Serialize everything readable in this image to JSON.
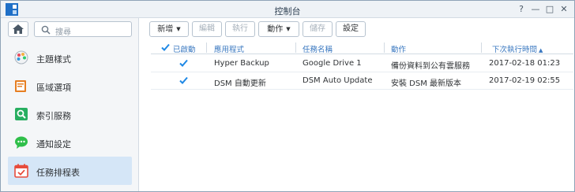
{
  "window": {
    "title": "控制台",
    "controls": [
      "?",
      "—",
      "□",
      "✕"
    ]
  },
  "sidebar": {
    "search_placeholder": "搜尋",
    "items": [
      {
        "label": "主題樣式",
        "icon": "palette-icon",
        "active": false
      },
      {
        "label": "區域選項",
        "icon": "regional-icon",
        "active": false
      },
      {
        "label": "索引服務",
        "icon": "index-search-icon",
        "active": false
      },
      {
        "label": "通知設定",
        "icon": "notification-icon",
        "active": false
      },
      {
        "label": "任務排程表",
        "icon": "calendar-check-icon",
        "active": true
      }
    ]
  },
  "toolbar": {
    "create": "新增",
    "edit": "編輯",
    "run": "執行",
    "action": "動作",
    "save": "儲存",
    "settings": "設定"
  },
  "grid": {
    "columns": {
      "enabled": "已啟動",
      "application": "應用程式",
      "task_name": "任務名稱",
      "action": "動作",
      "next_run": "下次執行時間"
    },
    "rows": [
      {
        "enabled": true,
        "application": "Hyper Backup",
        "task_name": "Google Drive 1",
        "action": "備份資料到公有雲服務",
        "next_run": "2017-02-18 01:23"
      },
      {
        "enabled": true,
        "application": "DSM 自動更新",
        "task_name": "DSM Auto Update",
        "action": "安裝 DSM 最新版本",
        "next_run": "2017-02-19 02:55"
      }
    ]
  },
  "colors": {
    "accent": "#1e88e5",
    "active_nav": "#d5e6f7",
    "header_text": "#3a78c0"
  }
}
